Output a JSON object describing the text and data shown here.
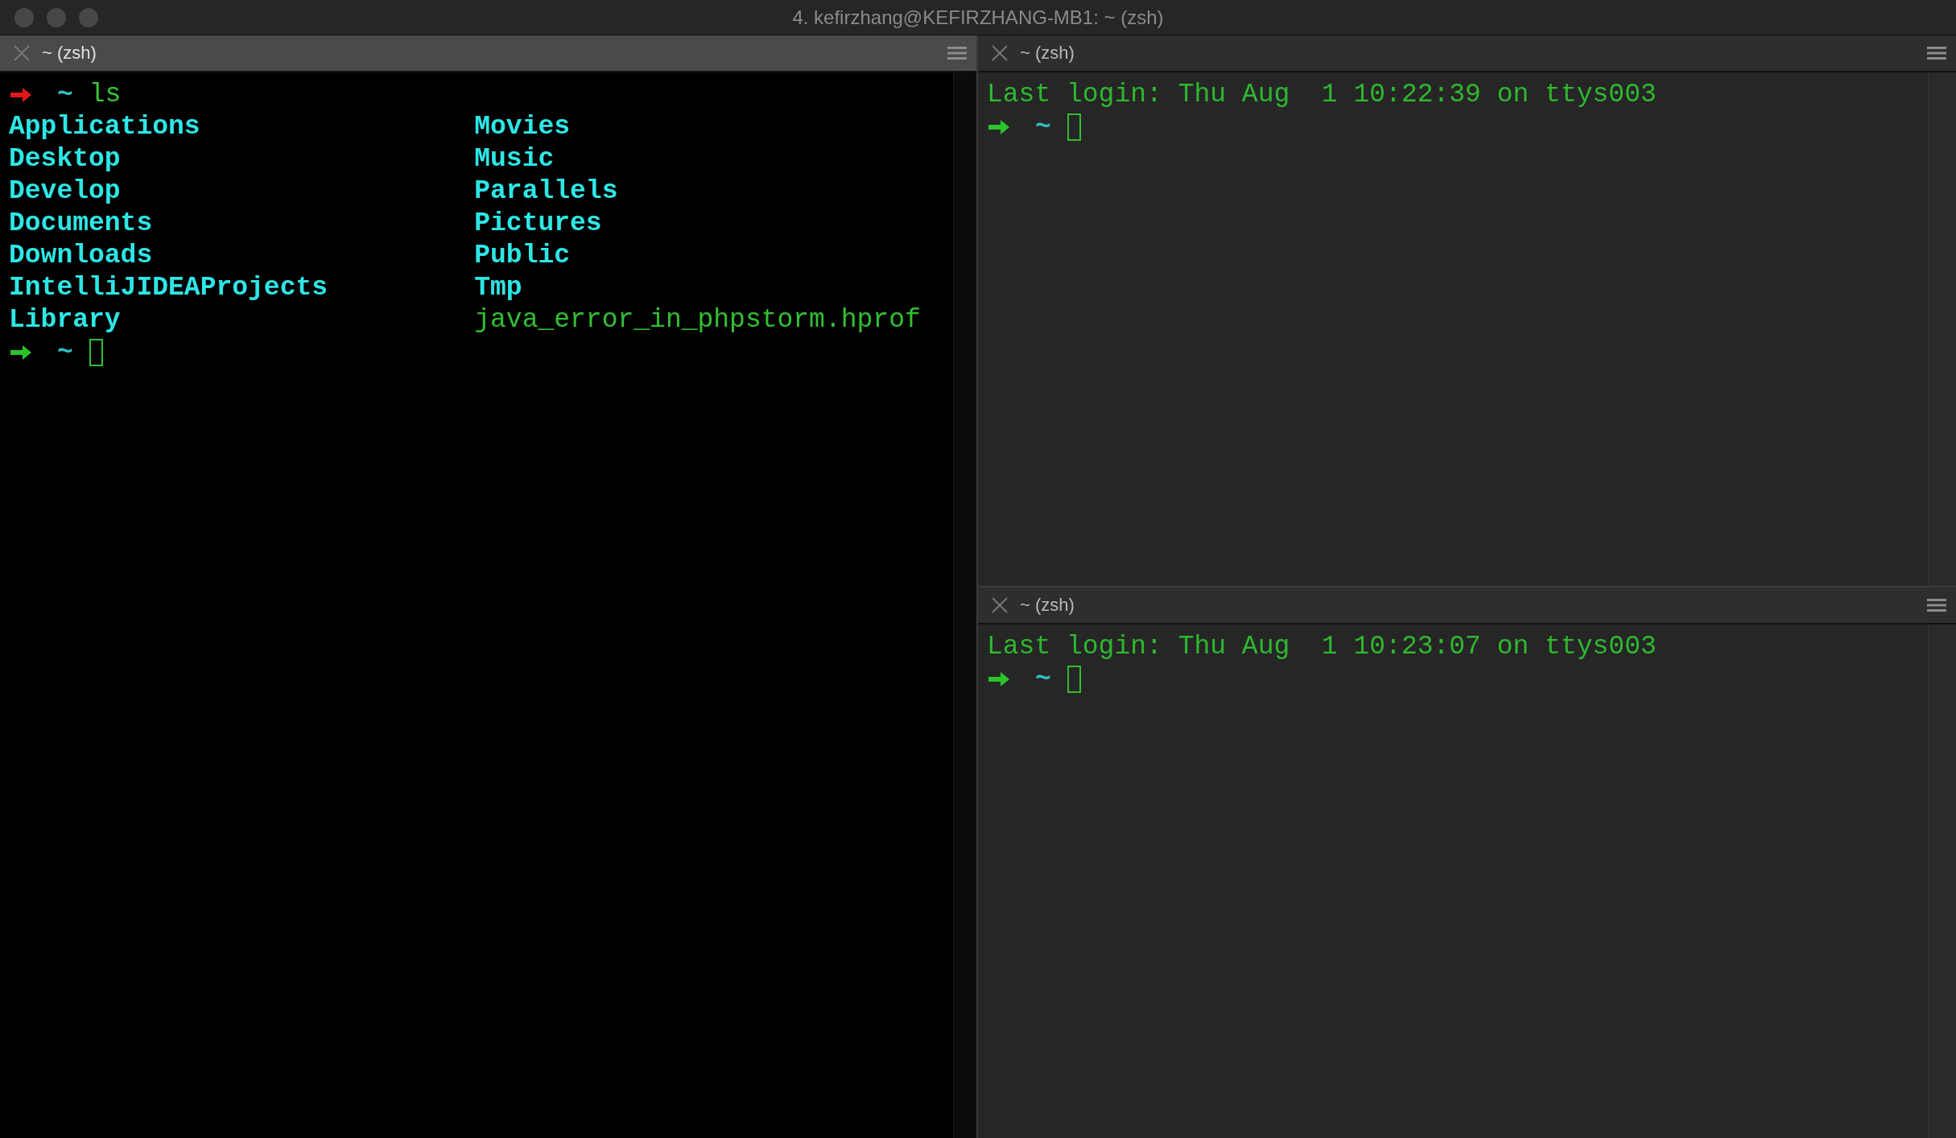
{
  "window": {
    "title": "4. kefirzhang@KEFIRZHANG-MB1: ~ (zsh)"
  },
  "panes": [
    {
      "tab_title": "~ (zsh)",
      "active": true,
      "lines": [
        {
          "kind": "prompt",
          "failed": true,
          "cwd": "~",
          "command": "ls",
          "cursor": false
        },
        {
          "kind": "listing",
          "items": [
            {
              "name": "Applications",
              "kind": "directory"
            },
            {
              "name": "Desktop",
              "kind": "directory"
            },
            {
              "name": "Develop",
              "kind": "directory"
            },
            {
              "name": "Documents",
              "kind": "directory"
            },
            {
              "name": "Downloads",
              "kind": "directory"
            },
            {
              "name": "IntelliJIDEAProjects",
              "kind": "directory"
            },
            {
              "name": "Library",
              "kind": "directory"
            },
            {
              "name": "Movies",
              "kind": "directory"
            },
            {
              "name": "Music",
              "kind": "directory"
            },
            {
              "name": "Parallels",
              "kind": "directory"
            },
            {
              "name": "Pictures",
              "kind": "directory"
            },
            {
              "name": "Public",
              "kind": "directory"
            },
            {
              "name": "Tmp",
              "kind": "directory"
            },
            {
              "name": "java_error_in_phpstorm.hprof",
              "kind": "file"
            }
          ]
        },
        {
          "kind": "prompt",
          "failed": false,
          "cwd": "~",
          "cursor": true
        }
      ]
    },
    {
      "tab_title": "~ (zsh)",
      "active": false,
      "lines": [
        {
          "kind": "text",
          "text": "Last login: Thu Aug  1 10:22:39 on ttys003"
        },
        {
          "kind": "prompt",
          "failed": false,
          "cwd": "~",
          "cursor": true
        }
      ]
    },
    {
      "tab_title": "~ (zsh)",
      "active": false,
      "lines": [
        {
          "kind": "text",
          "text": "Last login: Thu Aug  1 10:23:07 on ttys003"
        },
        {
          "kind": "prompt",
          "failed": false,
          "cwd": "~",
          "cursor": true
        }
      ]
    }
  ]
}
